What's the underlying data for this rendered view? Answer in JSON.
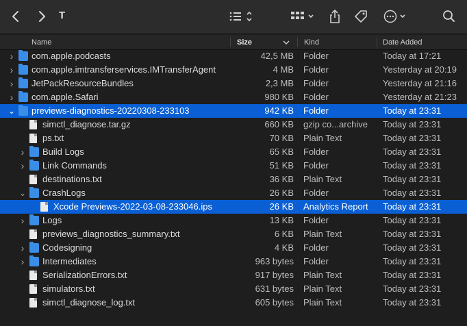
{
  "toolbar": {
    "title": "T",
    "back_icon": "chevron-left-icon",
    "forward_icon": "chevron-right-icon",
    "list_view_icon": "list-icon",
    "group_icon": "grid-icon",
    "share_icon": "share-icon",
    "tag_icon": "tag-icon",
    "more_icon": "ellipsis-circle-icon",
    "search_icon": "search-icon"
  },
  "columns": {
    "name": "Name",
    "size": "Size",
    "kind": "Kind",
    "date": "Date Added"
  },
  "colors": {
    "selection": "#0a5fd4",
    "folder": "#3b8ee8",
    "background": "#1e1e1e"
  },
  "rows": [
    {
      "name": "com.apple.podcasts",
      "size": "42,5 MB",
      "kind": "Folder",
      "date": "Today at 17:21",
      "type": "folder",
      "level": 0,
      "expanded": false
    },
    {
      "name": "com.apple.imtransferservices.IMTransferAgent",
      "size": "4 MB",
      "kind": "Folder",
      "date": "Yesterday at 20:19",
      "type": "folder",
      "level": 0,
      "expanded": false
    },
    {
      "name": "JetPackResourceBundles",
      "size": "2,3 MB",
      "kind": "Folder",
      "date": "Yesterday at 21:16",
      "type": "folder",
      "level": 0,
      "expanded": false
    },
    {
      "name": "com.apple.Safari",
      "size": "980 KB",
      "kind": "Folder",
      "date": "Yesterday at 21:23",
      "type": "folder",
      "level": 0,
      "expanded": false
    },
    {
      "name": "previews-diagnostics-20220308-233103",
      "size": "942 KB",
      "kind": "Folder",
      "date": "Today at 23:31",
      "type": "folder",
      "level": 0,
      "expanded": true,
      "selected": true
    },
    {
      "name": "simctl_diagnose.tar.gz",
      "size": "660 KB",
      "kind": "gzip co...archive",
      "date": "Today at 23:31",
      "type": "file",
      "level": 1
    },
    {
      "name": "ps.txt",
      "size": "70 KB",
      "kind": "Plain Text",
      "date": "Today at 23:31",
      "type": "file",
      "level": 1
    },
    {
      "name": "Build Logs",
      "size": "65 KB",
      "kind": "Folder",
      "date": "Today at 23:31",
      "type": "folder",
      "level": 1,
      "expanded": false
    },
    {
      "name": "Link Commands",
      "size": "51 KB",
      "kind": "Folder",
      "date": "Today at 23:31",
      "type": "folder",
      "level": 1,
      "expanded": false
    },
    {
      "name": "destinations.txt",
      "size": "36 KB",
      "kind": "Plain Text",
      "date": "Today at 23:31",
      "type": "file",
      "level": 1
    },
    {
      "name": "CrashLogs",
      "size": "26 KB",
      "kind": "Folder",
      "date": "Today at 23:31",
      "type": "folder",
      "level": 1,
      "expanded": true
    },
    {
      "name": "Xcode Previews-2022-03-08-233046.ips",
      "size": "26 KB",
      "kind": "Analytics Report",
      "date": "Today at 23:31",
      "type": "file",
      "level": 2,
      "selected": true
    },
    {
      "name": "Logs",
      "size": "13 KB",
      "kind": "Folder",
      "date": "Today at 23:31",
      "type": "folder",
      "level": 1,
      "expanded": false
    },
    {
      "name": "previews_diagnostics_summary.txt",
      "size": "6 KB",
      "kind": "Plain Text",
      "date": "Today at 23:31",
      "type": "file",
      "level": 1
    },
    {
      "name": "Codesigning",
      "size": "4 KB",
      "kind": "Folder",
      "date": "Today at 23:31",
      "type": "folder",
      "level": 1,
      "expanded": false
    },
    {
      "name": "Intermediates",
      "size": "963 bytes",
      "kind": "Folder",
      "date": "Today at 23:31",
      "type": "folder",
      "level": 1,
      "expanded": false
    },
    {
      "name": "SerializationErrors.txt",
      "size": "917 bytes",
      "kind": "Plain Text",
      "date": "Today at 23:31",
      "type": "file",
      "level": 1
    },
    {
      "name": "simulators.txt",
      "size": "631 bytes",
      "kind": "Plain Text",
      "date": "Today at 23:31",
      "type": "file",
      "level": 1
    },
    {
      "name": "simctl_diagnose_log.txt",
      "size": "605 bytes",
      "kind": "Plain Text",
      "date": "Today at 23:31",
      "type": "file",
      "level": 1
    }
  ]
}
